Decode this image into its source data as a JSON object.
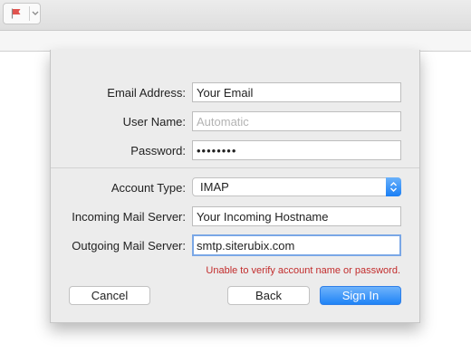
{
  "toolbar": {
    "flag_icon": "flag-icon",
    "menu_icon": "chevron-down-icon",
    "flag_color": "#e0534f"
  },
  "form": {
    "email_label": "Email Address:",
    "email_value": "Your Email",
    "username_label": "User Name:",
    "username_placeholder": "Automatic",
    "password_label": "Password:",
    "password_value": "••••••••",
    "account_type_label": "Account Type:",
    "account_type_value": "IMAP",
    "incoming_label": "Incoming Mail Server:",
    "incoming_value": "Your Incoming Hostname",
    "outgoing_label": "Outgoing Mail Server:",
    "outgoing_value": "smtp.siterubix.com",
    "error_message": "Unable to verify account name or password."
  },
  "buttons": {
    "cancel": "Cancel",
    "back": "Back",
    "sign_in": "Sign In"
  },
  "colors": {
    "accent": "#1f83f6",
    "error": "#c22c2c"
  }
}
